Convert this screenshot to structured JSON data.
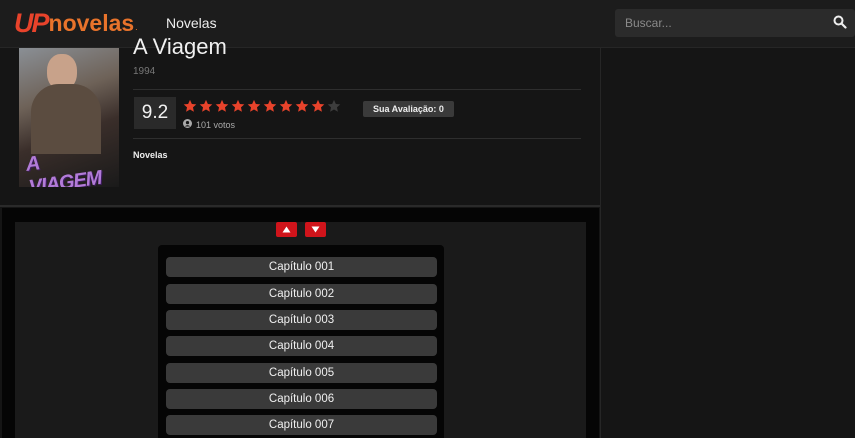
{
  "header": {
    "logo_up": "UP",
    "logo_novelas": "novelas",
    "logo_dot": ".",
    "nav_link": "Novelas",
    "search_placeholder": "Buscar..."
  },
  "show": {
    "title": "A Viagem",
    "year": "1994",
    "poster_text": "A VIAGEM",
    "score": "9.2",
    "rating": 9,
    "rating_max": 10,
    "votes": "101 votos",
    "user_rating_label": "Sua Avaliação: 0",
    "genre": "Novelas"
  },
  "episodes": [
    "Capítulo 001",
    "Capítulo 002",
    "Capítulo 003",
    "Capítulo 004",
    "Capítulo 005",
    "Capítulo 006",
    "Capítulo 007"
  ],
  "colors": {
    "accent": "#e8432b",
    "star_on": "#e8432b",
    "star_off": "#3d3d3d",
    "button_red": "#d0141b"
  },
  "icons": {
    "search": "search-icon",
    "user": "user-icon",
    "up": "arrow-up-icon",
    "down": "arrow-down-icon"
  }
}
